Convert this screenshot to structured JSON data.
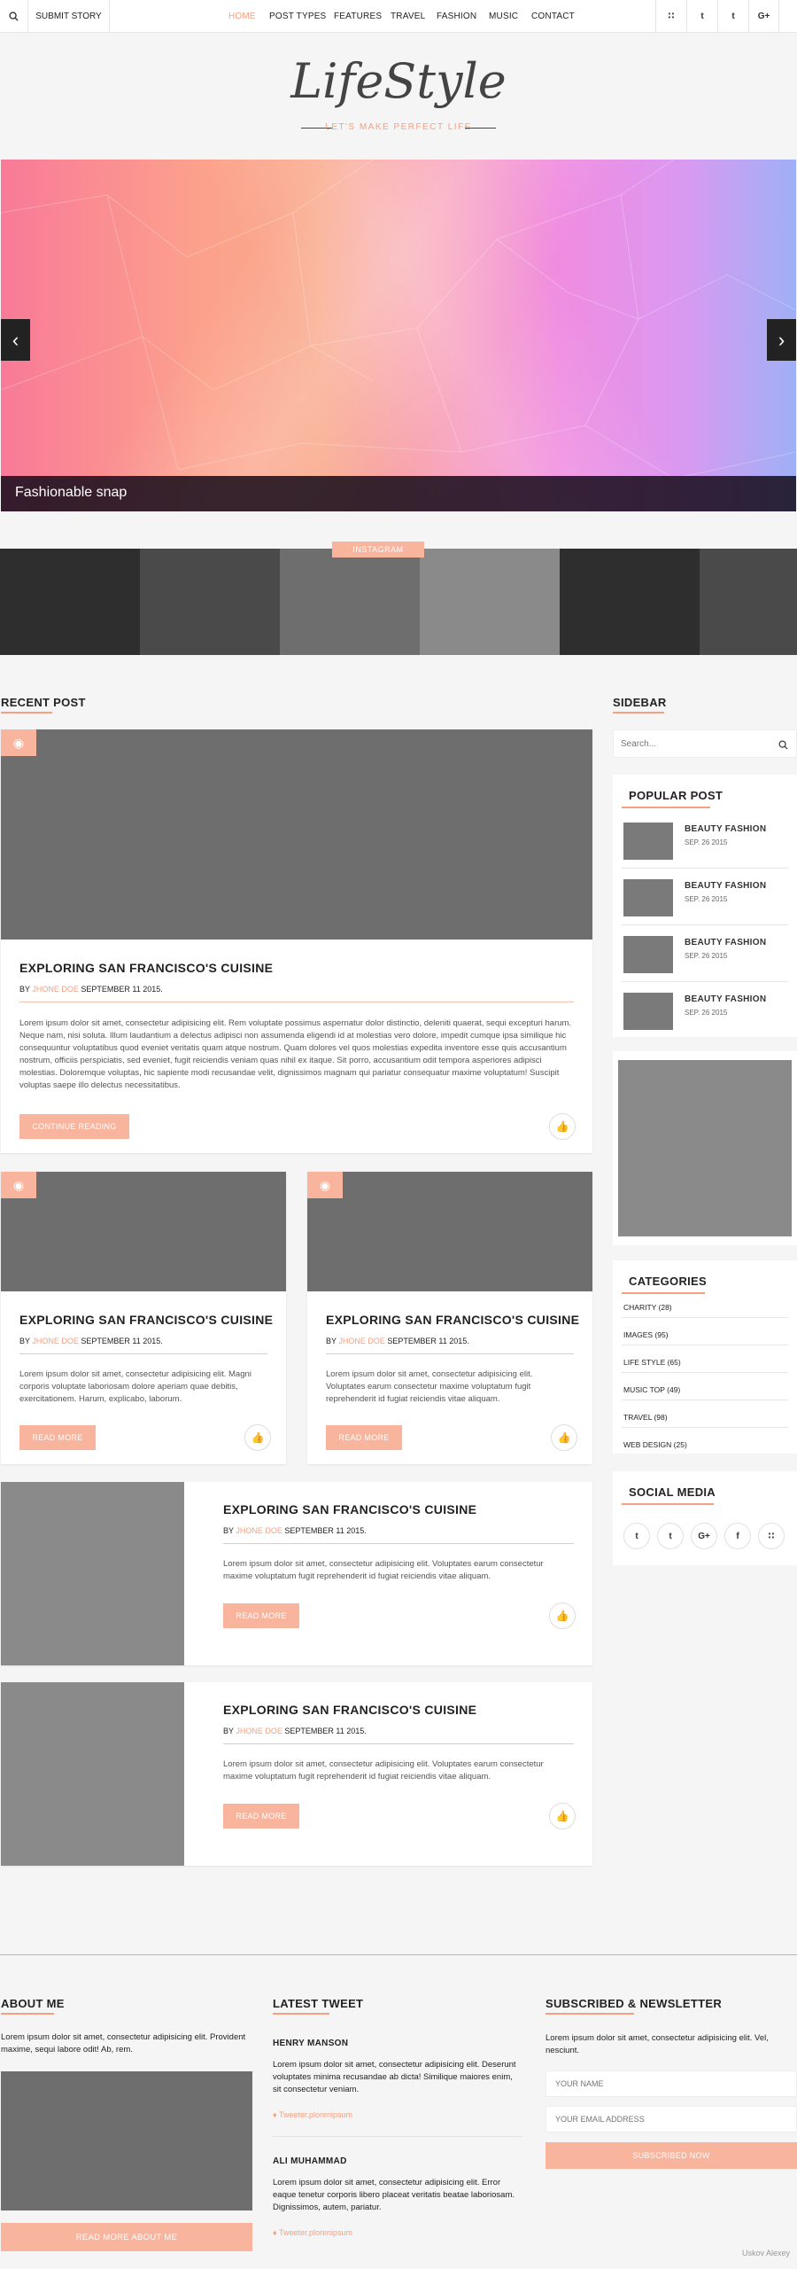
{
  "topbar": {
    "search_icon": "search-icon",
    "submit_label": "SUBMIT STORY",
    "nav": [
      "HOME",
      "POST TYPES",
      "FEATURES",
      "TRAVEL",
      "FASHION",
      "MUSIC",
      "CONTACT"
    ],
    "social": [
      "rss-icon",
      "twitter-icon",
      "tumblr-icon",
      "google-plus-icon"
    ],
    "social_glyphs": [
      "∷",
      "t",
      "t",
      "G+"
    ]
  },
  "brand": {
    "logo": "LifeStyle",
    "tagline": "LET'S MAKE PERFECT LIFE"
  },
  "hero": {
    "caption": "Fashionable snap",
    "prev": "‹",
    "next": "›"
  },
  "instagram": {
    "label": "INSTAGRAM"
  },
  "recent": {
    "heading": "RECENT POST",
    "featured": {
      "title": "EXPLORING SAN FRANCISCO'S CUISINE",
      "by": "BY",
      "author": "JHONE DOE",
      "date": "SEPTEMBER 11 2015.",
      "body": "Lorem ipsum dolor sit amet, consectetur adipisicing elit. Rem voluptate possimus aspernatur dolor distinctio, deleniti quaerat, sequi excepturi harum. Neque nam, nisi soluta. Illum laudantium a delectus adipisci non assumenda eligendi id at molestias vero dolore, impedit cumque ipsa similique hic consequuntur voluptatibus quod eveniet veritatis quam atque nostrum. Quam dolores vel quos molestias expedita inventore esse quis accusantium nostrum, officiis perspiciatis, sed eveniet, fugit reiciendis veniam quas nihil ex itaque. Sit porro, accusantium odit tempora asperiores adipisci molestias. Doloremque voluptas, hic sapiente modi recusandae velit, dignissimos magnam qui pariatur consequatur maxime voluptatum! Suscipit voluptas saepe illo delectus necessitatibus.",
      "button": "CONTINUE READING"
    },
    "grid": [
      {
        "title": "EXPLORING SAN FRANCISCO'S CUISINE",
        "by": "BY",
        "author": "JHONE DOE",
        "date": "SEPTEMBER 11 2015.",
        "body": "Lorem ipsum dolor sit amet, consectetur adipisicing elit. Magni corporis voluptate laboriosam dolore aperiam quae debitis, exercitationem. Harum, explicabo, laborum.",
        "button": "READ MORE"
      },
      {
        "title": "EXPLORING SAN FRANCISCO'S CUISINE",
        "by": "BY",
        "author": "JHONE DOE",
        "date": "SEPTEMBER 11 2015.",
        "body": "Lorem ipsum dolor sit amet, consectetur adipisicing elit. Voluptates earum consectetur maxime voluptatum fugit reprehenderit id fugiat reiciendis vitae aliquam.",
        "button": "READ MORE"
      }
    ],
    "list": [
      {
        "title": "EXPLORING SAN FRANCISCO'S CUISINE",
        "by": "BY",
        "author": "JHONE DOE",
        "date": "SEPTEMBER 11 2015.",
        "body": "Lorem ipsum dolor sit amet, consectetur adipisicing elit. Voluptates earum consectetur maxime voluptatum fugit reprehenderit id fugiat reiciendis vitae aliquam.",
        "button": "READ MORE"
      },
      {
        "title": "EXPLORING SAN FRANCISCO'S CUISINE",
        "by": "BY",
        "author": "JHONE DOE",
        "date": "SEPTEMBER 11 2015.",
        "body": "Lorem ipsum dolor sit amet, consectetur adipisicing elit. Voluptates earum consectetur maxime voluptatum fugit reprehenderit id fugiat reiciendis vitae aliquam.",
        "button": "READ MORE"
      }
    ]
  },
  "sidebar": {
    "heading": "SIDEBAR",
    "search_placeholder": "Search...",
    "popular_heading": "POPULAR POST",
    "popular": [
      {
        "title": "BEAUTY FASHION",
        "date": "SEP. 26 2015"
      },
      {
        "title": "BEAUTY FASHION",
        "date": "SEP. 26 2015"
      },
      {
        "title": "BEAUTY FASHION",
        "date": "SEP. 26 2015"
      },
      {
        "title": "BEAUTY FASHION",
        "date": "SEP. 26 2015"
      }
    ],
    "categories_heading": "CATEGORIES",
    "categories": [
      "CHARITY (28)",
      "IMAGES (95)",
      "LIFE STYLE (65)",
      "MUSIC TOP (49)",
      "TRAVEL (98)",
      "WEB DESIGN (25)"
    ],
    "social_heading": "SOCIAL MEDIA",
    "social": [
      "twitter-icon",
      "tumblr-icon",
      "google-plus-icon",
      "facebook-icon",
      "rss-icon"
    ],
    "social_glyphs": [
      "t",
      "t",
      "G+",
      "f",
      "∷"
    ]
  },
  "footer": {
    "about_heading": "ABOUT ME",
    "about_text": "Lorem ipsum dolor sit amet, consectetur adipisicing elit. Provident maxime, sequi labore odit! Ab, rem.",
    "about_button": "READ MORE ABOUT ME",
    "tweet_heading": "LATEST TWEET",
    "tweets": [
      {
        "name": "HENRY MANSON",
        "text": "Lorem ipsum dolor sit amet, consectetur adipisicing elit. Deserunt voluptates minima recusandae ab dicta! Similique maiores enim, sit consectetur veniam.",
        "link": "Tweeter.plorenipsum"
      },
      {
        "name": "ALI MUHAMMAD",
        "text": "Lorem ipsum dolor sit amet, consectetur adipisicing elit. Error eaque tenetur corporis libero placeat veritatis beatae laboriosam. Dignissimos, autem, pariatur.",
        "link": "Tweeter.plorenipsum"
      }
    ],
    "newsletter_heading": "SUBSCRIBED & NEWSLETTER",
    "newsletter_text": "Lorem ipsum dolor sit amet, consectetur adipisicing elit. Vel, nesciunt.",
    "name_placeholder": "YOUR NAME",
    "email_placeholder": "YOUR EMAIL ADDRESS",
    "subscribe_button": "SUBSCRIBED NOW"
  },
  "credit": "Uskov Alexey",
  "colors": {
    "accent": "#f5a080",
    "button": "#f9b49e",
    "dark": "#222222"
  }
}
